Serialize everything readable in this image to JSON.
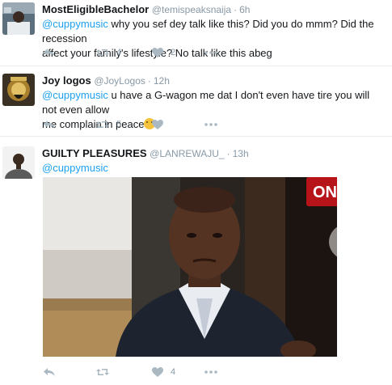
{
  "tweets": [
    {
      "name": "MostEligibleBachelor",
      "handle": "@temispeaksnaija",
      "time": "6h",
      "mention": "@cuppymusic",
      "body_line1": " why you sef dey talk like this?  Did you do mmm? Did the recession",
      "body_line2": "affect your family's lifestyle?  No talk like this abeg",
      "retweets": "4",
      "likes": "2"
    },
    {
      "name": "Joy logos",
      "handle": "@JoyLogos",
      "time": "12h",
      "mention": "@cuppymusic",
      "body_line1": " u have a G-wagon me dat I don't even have tire you will not even allow",
      "body_line2": "me complain in peace",
      "retweets": "5",
      "likes": ""
    },
    {
      "name": "GUILTY PLEASURES",
      "handle": "@LANREWAJU_",
      "time": "13h",
      "mention": "@cuppymusic",
      "retweets": "",
      "likes": "4",
      "photo_sign": "ON AIR"
    }
  ],
  "separator": "·",
  "icons": [
    "reply-icon",
    "retweet-icon",
    "like-icon",
    "more-icon"
  ],
  "colors": {
    "mention": "#1da1f2",
    "meta": "#8899a6",
    "icon": "#aab8c2"
  }
}
